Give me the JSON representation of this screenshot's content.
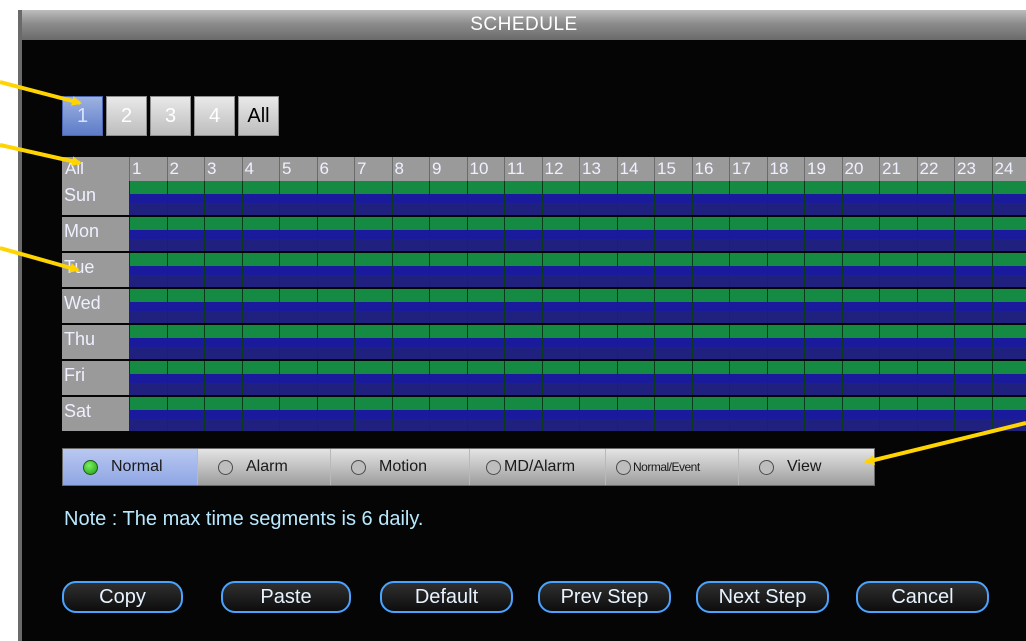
{
  "window": {
    "title": "SCHEDULE"
  },
  "channels": [
    {
      "label": "1",
      "active": true
    },
    {
      "label": "2",
      "active": false
    },
    {
      "label": "3",
      "active": false
    },
    {
      "label": "4",
      "active": false
    },
    {
      "label": "All",
      "active": false
    }
  ],
  "header": {
    "corner": "All",
    "hours": [
      "1",
      "2",
      "3",
      "4",
      "5",
      "6",
      "7",
      "8",
      "9",
      "10",
      "11",
      "12",
      "13",
      "14",
      "15",
      "16",
      "17",
      "18",
      "19",
      "20",
      "21",
      "22",
      "23",
      "24"
    ]
  },
  "days": [
    "Sun",
    "Mon",
    "Tue",
    "Wed",
    "Thu",
    "Fri",
    "Sat"
  ],
  "modes": [
    {
      "label": "Normal",
      "selected": true
    },
    {
      "label": "Alarm",
      "selected": false
    },
    {
      "label": "Motion",
      "selected": false
    },
    {
      "label": "MD/Alarm",
      "selected": false
    },
    {
      "label": "Normal/Event",
      "selected": false
    },
    {
      "label": "View",
      "selected": false
    }
  ],
  "note": "Note : The max time segments is 6 daily.",
  "buttons": [
    "Copy",
    "Paste",
    "Default",
    "Prev Step",
    "Next Step",
    "Cancel"
  ],
  "colors": {
    "record_band": "#158a43",
    "idle_band": "#1a1a9c",
    "button_border": "#4aa3ff",
    "annotation_arrow": "#ffd400"
  },
  "icons": [
    "radio-selected-icon",
    "radio-unselected-icon",
    "callout-arrow-icon"
  ]
}
